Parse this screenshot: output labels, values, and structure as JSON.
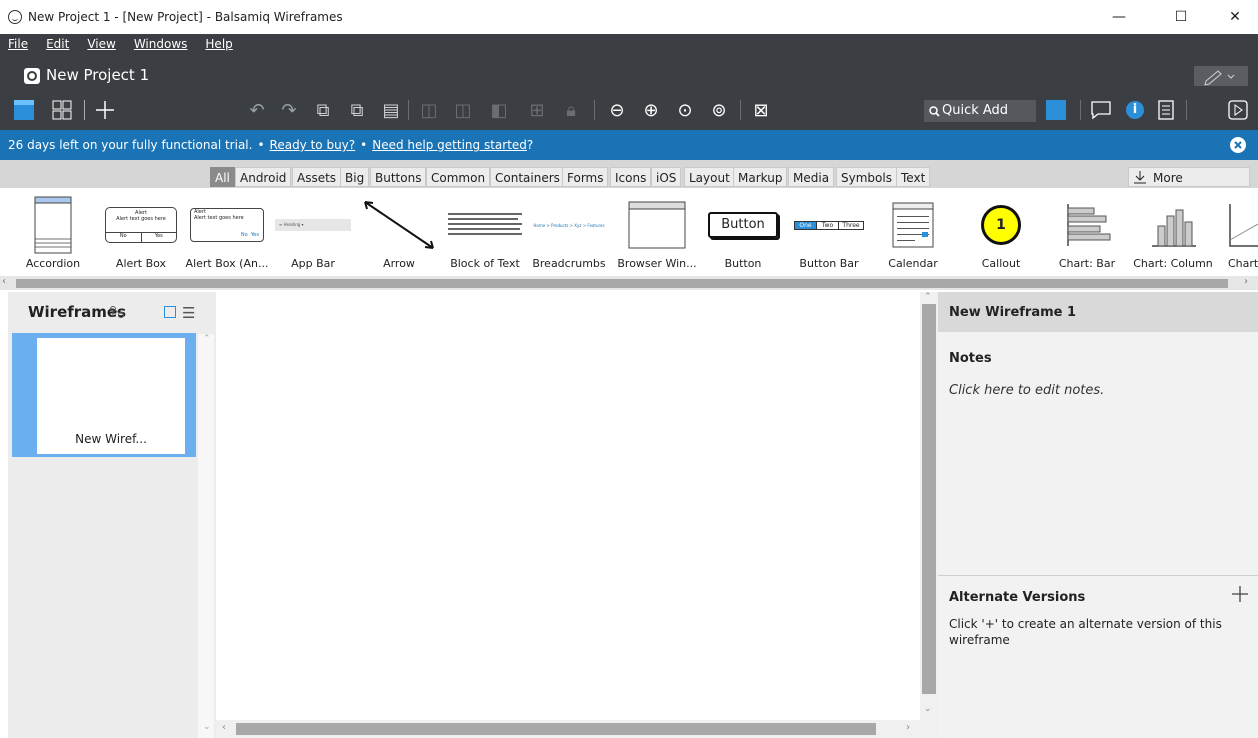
{
  "window": {
    "title": "New Project 1 - [New Project] - Balsamiq Wireframes",
    "controls": {
      "minimize": "—",
      "maximize": "☐",
      "close": "✕"
    }
  },
  "menu": [
    "File",
    "Edit",
    "View",
    "Windows",
    "Help"
  ],
  "project": {
    "name": "New Project 1"
  },
  "toolbar": {
    "quick_add_label": "Quick Add"
  },
  "trial": {
    "text": "26 days left on your fully functional trial.",
    "sep1": "•",
    "ready_link": "Ready to buy?",
    "sep2": "•",
    "help_link": "Need help getting started",
    "help_suffix": "?"
  },
  "categories": [
    "All",
    "Android",
    "Assets",
    "Big",
    "Buttons",
    "Common",
    "Containers",
    "Forms",
    "Icons",
    "iOS",
    "Layout",
    "Markup",
    "Media",
    "Symbols",
    "Text"
  ],
  "more_controls": "More Controls...",
  "library": [
    {
      "label": "Accordion",
      "icon": "accordion-icon"
    },
    {
      "label": "Alert Box",
      "icon": "alert-box-icon"
    },
    {
      "label": "Alert Box (An...",
      "icon": "alert-box-android-icon"
    },
    {
      "label": "App Bar",
      "icon": "app-bar-icon"
    },
    {
      "label": "Arrow",
      "icon": "arrow-icon"
    },
    {
      "label": "Block of Text",
      "icon": "block-of-text-icon"
    },
    {
      "label": "Breadcrumbs",
      "icon": "breadcrumbs-icon"
    },
    {
      "label": "Browser Win...",
      "icon": "browser-window-icon"
    },
    {
      "label": "Button",
      "icon": "button-icon"
    },
    {
      "label": "Button Bar",
      "icon": "button-bar-icon"
    },
    {
      "label": "Calendar",
      "icon": "calendar-icon"
    },
    {
      "label": "Callout",
      "icon": "callout-icon"
    },
    {
      "label": "Chart: Bar",
      "icon": "chart-bar-icon"
    },
    {
      "label": "Chart: Column",
      "icon": "chart-column-icon"
    },
    {
      "label": "Chart",
      "icon": "chart-line-icon"
    }
  ],
  "thumb_text": {
    "alert_title": "Alert",
    "alert_body": "Alert text goes here",
    "alert_no": "No",
    "alert_yes": "Yes",
    "button": "Button",
    "btnbar": [
      "One",
      "Two",
      "Three"
    ],
    "breadcrumbs": "Home > Products > Xyz > Features",
    "callout": "1",
    "app_bar": "Heading"
  },
  "wireframes": {
    "header": "Wireframes",
    "items": [
      {
        "label": "New Wiref..."
      }
    ]
  },
  "right": {
    "title": "New Wireframe 1",
    "notes_header": "Notes",
    "notes_placeholder": "Click here to edit notes.",
    "alt_header": "Alternate Versions",
    "alt_text": "Click '+' to create an alternate version of this wireframe"
  },
  "colors": {
    "dark_bar": "#3b3e42",
    "trial_blue": "#1a73b5",
    "selection": "#6ab0f0",
    "accent_yellow": "#ffff00"
  }
}
